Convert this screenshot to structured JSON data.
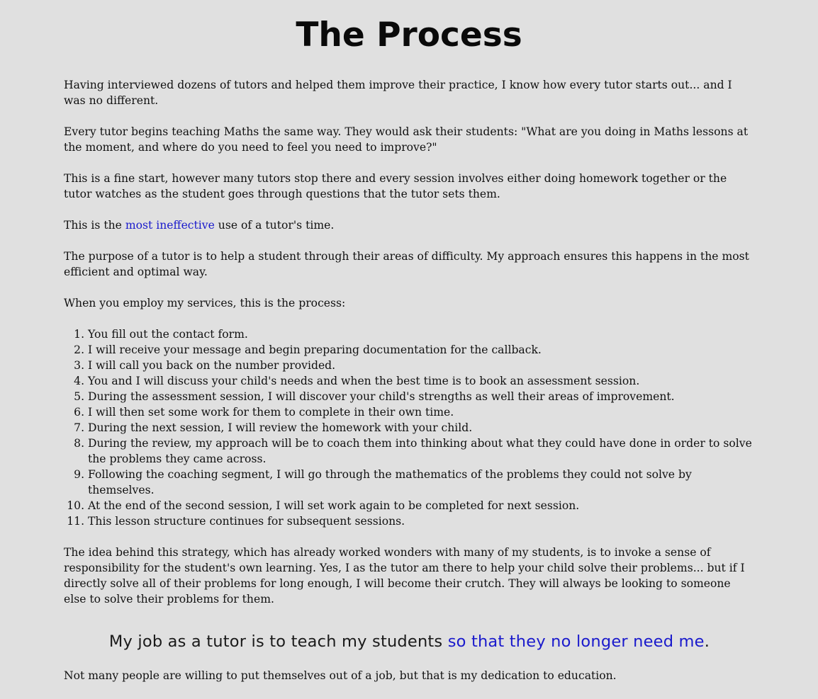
{
  "title": "The Process",
  "paragraphs": {
    "p1": "Having interviewed dozens of tutors and helped them improve their practice, I know how every tutor starts out... and I was no different.",
    "p2": "Every tutor begins teaching Maths the same way. They would ask their students: \"What are you doing in Maths lessons at the moment, and where do you need to feel you need to improve?\"",
    "p3": "This is a fine start, however many tutors stop there and every session involves either doing homework together or the tutor watches as the student goes through questions that the tutor sets them.",
    "p4_before": "This is the ",
    "p4_highlight": "most ineffective",
    "p4_after": " use of a tutor's time.",
    "p5": "The purpose of a tutor is to help a student through their areas of difficulty. My approach ensures this happens in the most efficient and optimal way.",
    "p6": "When you employ my services, this is the process:",
    "p7": "The idea behind this strategy, which has already worked wonders with many of my students, is to invoke a sense of responsibility for the student's own learning. Yes, I as the tutor am there to help your child solve their problems... but if I directly solve all of their problems for long enough, I will become their crutch. They will always be looking to someone else to solve their problems for them.",
    "p8": "Not many people are willing to put themselves out of a job, but that is my dedication to education."
  },
  "steps": [
    "You fill out the contact form.",
    "I will receive your message and begin preparing documentation for the callback.",
    "I will call you back on the number provided.",
    "You and I will discuss your child's needs and when the best time is to book an assessment session.",
    "During the assessment session, I will discover your child's strengths as well their areas of improvement.",
    "I will then set some work for them to complete in their own time.",
    "During the next session, I will review the homework with your child.",
    "During the review, my approach will be to coach them into thinking about what they could have done in order to solve the problems they came across.",
    "Following the coaching segment, I will go through the mathematics of the problems they could not solve by themselves.",
    "At the end of the second session, I will set work again to be completed for next session.",
    "This lesson structure continues for subsequent sessions."
  ],
  "quote": {
    "before": "My job as a tutor is to teach my students ",
    "highlight": "so that they no longer need me",
    "after": "."
  },
  "colors": {
    "background": "#e0e0e0",
    "highlight": "#1a1acc",
    "text": "#111111"
  }
}
